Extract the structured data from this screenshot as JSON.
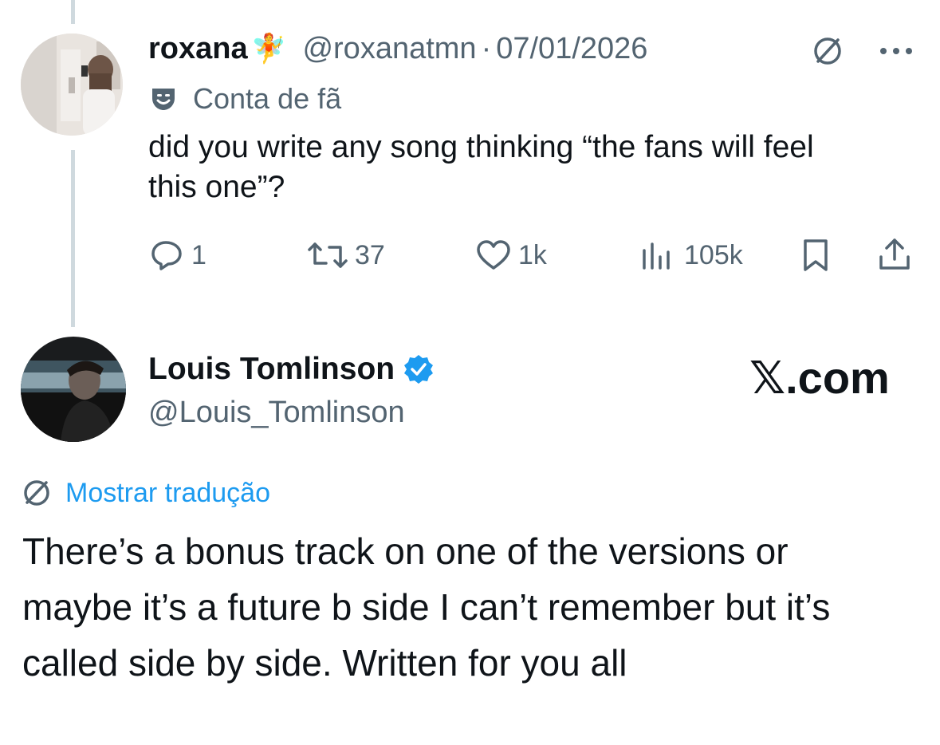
{
  "reply": {
    "display_name": "roxana",
    "name_emoji": "🧚",
    "handle": "@roxanatmn",
    "separator": "·",
    "date": "07/01/2026",
    "label": "Conta de fã",
    "text": "did you write any song thinking “the fans will feel this one”?",
    "actions": {
      "replies": "1",
      "reposts": "37",
      "likes": "1k",
      "views": "105k"
    }
  },
  "main_tweet": {
    "display_name": "Louis Tomlinson",
    "handle": "@Louis_Tomlinson",
    "watermark": "𝕏.com",
    "translate_label": "Mostrar tradução",
    "text": "There’s a bonus track on one of the versions or maybe it’s a future b side I can’t remember but it’s called side by side. Written for you all"
  },
  "colors": {
    "text": "#0f1419",
    "secondary": "#536471",
    "link": "#1d9bf0",
    "verified": "#1d9bf0",
    "thread_line": "#cfd9de"
  }
}
